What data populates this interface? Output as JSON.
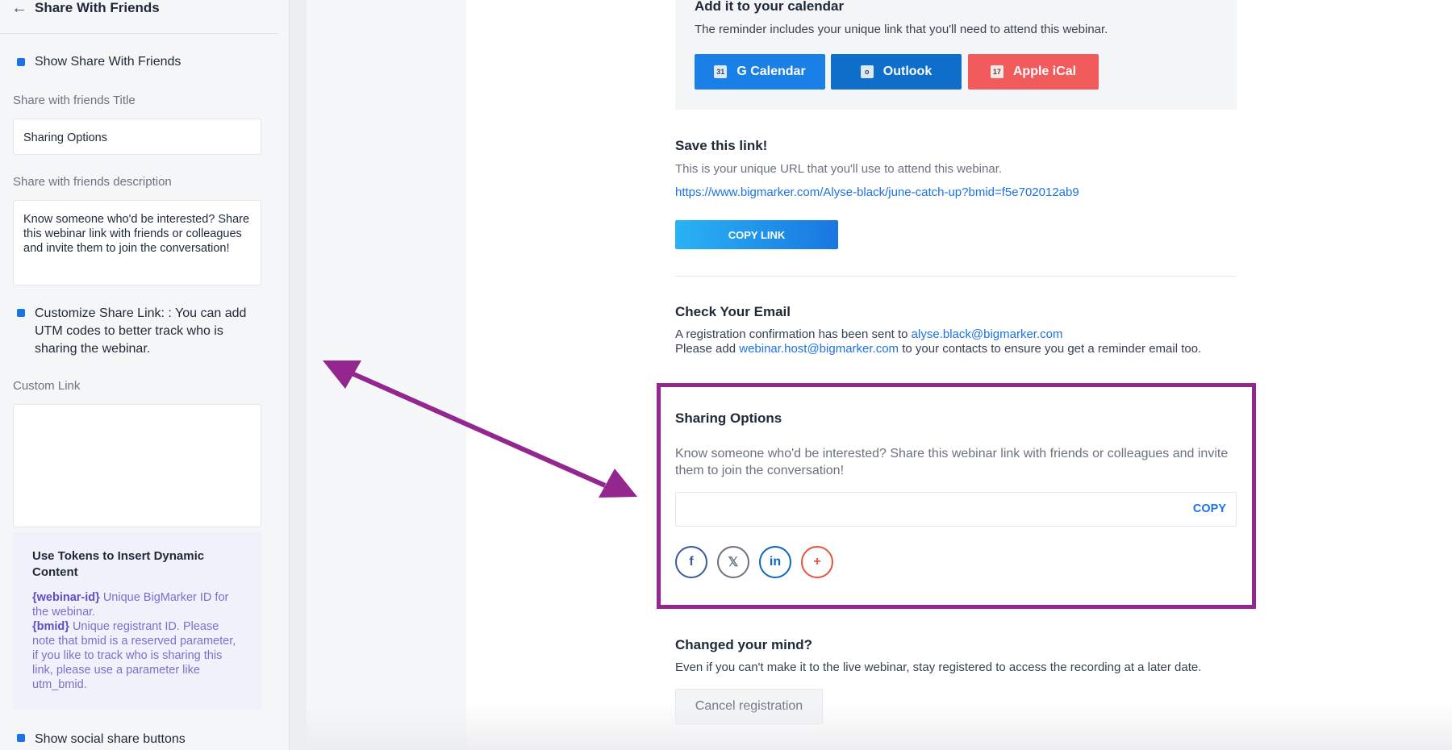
{
  "sidebar": {
    "back_icon": "arrow-left-icon",
    "title": "Share With Friends",
    "show_share_label": "Show Share With Friends",
    "title_label": "Share with friends Title",
    "title_value": "Sharing Options",
    "desc_label": "Share with friends description",
    "desc_value": "Know someone who'd be interested? Share this webinar link with friends or colleagues and invite them to join the conversation!",
    "customize_label": "Customize Share Link: : You can add UTM codes to better track who is sharing the webinar.",
    "custom_link_label": "Custom Link",
    "custom_link_value": "",
    "tokens": {
      "title": "Use Tokens to Insert Dynamic Content",
      "token1_name": "{webinar-id}",
      "token1_desc": " Unique BigMarker ID for the webinar.",
      "token2_name": "{bmid}",
      "token2_desc": " Unique registrant ID. Please note that bmid is a reserved parameter, if you like to track who is sharing this link, please use a parameter like utm_bmid."
    },
    "show_social_label": "Show social share buttons"
  },
  "calendar": {
    "title": "Add it to your calendar",
    "desc": "The reminder includes your unique link that you'll need to attend this webinar.",
    "buttons": [
      {
        "label": "G Calendar",
        "color": "#1a7fe6",
        "icon": "31"
      },
      {
        "label": "Outlook",
        "color": "#0f6ec9",
        "icon": "o"
      },
      {
        "label": "Apple iCal",
        "color": "#f25b5b",
        "icon": "17"
      }
    ]
  },
  "save_link": {
    "title": "Save this link!",
    "desc": "This is your unique URL that you'll use to attend this webinar.",
    "url": "https://www.bigmarker.com/Alyse-black/june-catch-up?bmid=f5e702012ab9",
    "copy_label": "COPY LINK"
  },
  "check_email": {
    "title": "Check Your Email",
    "line1_prefix": "A registration confirmation has been sent to ",
    "line1_email": "alyse.black@bigmarker.com",
    "line2_prefix": "Please add ",
    "line2_email": "webinar.host@bigmarker.com",
    "line2_suffix": " to your contacts to ensure you get a reminder email too."
  },
  "sharing": {
    "title": "Sharing Options",
    "desc": "Know someone who'd be interested? Share this webinar link with friends or colleagues and invite them to join the conversation!",
    "copy_label": "COPY",
    "social": [
      {
        "name": "facebook-icon",
        "glyph": "f",
        "color": "#3b5998"
      },
      {
        "name": "x-twitter-icon",
        "glyph": "𝕏",
        "color": "#6b7280"
      },
      {
        "name": "linkedin-icon",
        "glyph": "in",
        "color": "#0a66c2"
      },
      {
        "name": "more-share-icon",
        "glyph": "+",
        "color": "#e8533f"
      }
    ]
  },
  "changed_mind": {
    "title": "Changed your mind?",
    "desc": "Even if you can't make it to the live webinar, stay registered to access the recording at a later date.",
    "cancel_label": "Cancel registration"
  },
  "colors": {
    "accent": "#1a73e8",
    "highlight": "#93268f"
  }
}
